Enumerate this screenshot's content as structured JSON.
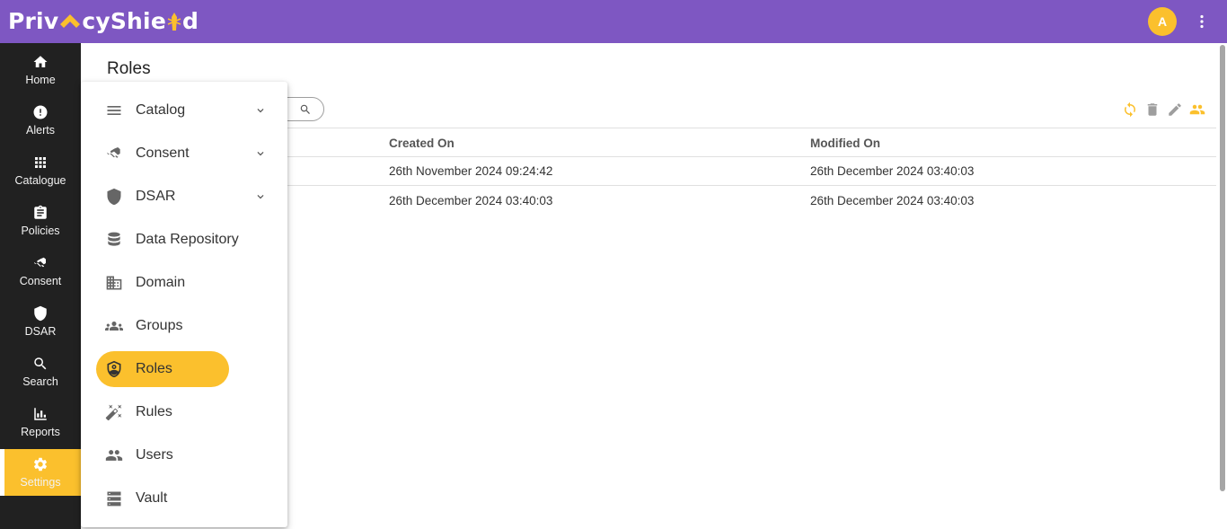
{
  "app": {
    "logo_text": "PrivacyShield",
    "logo_left": "Priv",
    "logo_right": "cyShie",
    "logo_end": "d",
    "avatar_initial": "A",
    "accent_color": "#7e57c2",
    "highlight_color": "#fbc02d"
  },
  "rail": {
    "items": [
      {
        "label": "Home",
        "icon": "home-icon"
      },
      {
        "label": "Alerts",
        "icon": "alert-icon"
      },
      {
        "label": "Catalogue",
        "icon": "grid-icon"
      },
      {
        "label": "Policies",
        "icon": "clipboard-icon"
      },
      {
        "label": "Consent",
        "icon": "handshake-icon"
      },
      {
        "label": "DSAR",
        "icon": "shield-icon"
      },
      {
        "label": "Search",
        "icon": "search-icon"
      },
      {
        "label": "Reports",
        "icon": "bar-chart-icon"
      },
      {
        "label": "Settings",
        "icon": "gear-icon",
        "active": true
      }
    ]
  },
  "page": {
    "title": "Roles"
  },
  "table": {
    "columns": [
      "Created On",
      "Modified On"
    ],
    "rows": [
      {
        "created": "26th November 2024 09:24:42",
        "modified": "26th December 2024 03:40:03"
      },
      {
        "created": "26th December 2024 03:40:03",
        "modified": "26th December 2024 03:40:03"
      }
    ]
  },
  "settings_menu": {
    "items": [
      {
        "label": "Catalog",
        "icon": "list-icon",
        "expandable": true
      },
      {
        "label": "Consent",
        "icon": "handshake-icon",
        "expandable": true
      },
      {
        "label": "DSAR",
        "icon": "shield-icon",
        "expandable": true
      },
      {
        "label": "Data Repository",
        "icon": "database-icon"
      },
      {
        "label": "Domain",
        "icon": "building-icon"
      },
      {
        "label": "Groups",
        "icon": "groups-icon"
      },
      {
        "label": "Roles",
        "icon": "admin-shield-icon",
        "active": true
      },
      {
        "label": "Rules",
        "icon": "rules-icon"
      },
      {
        "label": "Users",
        "icon": "users-icon"
      },
      {
        "label": "Vault",
        "icon": "vault-icon"
      }
    ]
  }
}
